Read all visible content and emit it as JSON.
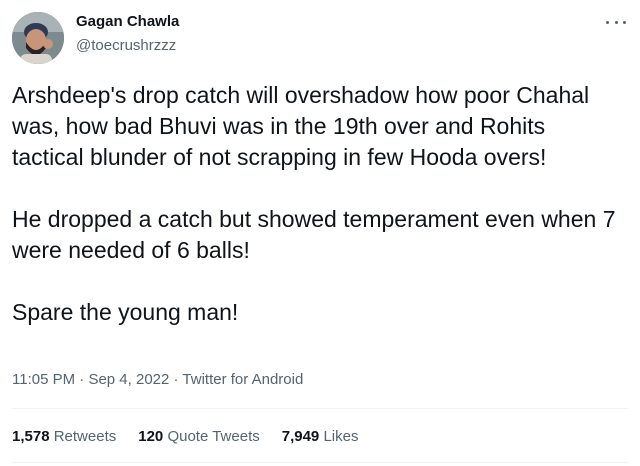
{
  "author": {
    "display_name": "Gagan Chawla",
    "handle": "@toecrushrzzz",
    "avatar_icon": "profile-photo"
  },
  "tweet": {
    "paragraphs": [
      "Arshdeep's drop catch will overshadow how poor Chahal was, how bad Bhuvi was in the 19th over and Rohits tactical blunder of not scrapping in few Hooda overs!",
      "He dropped a catch but showed temperament even when 7 were needed of 6 balls!",
      "Spare the young man!"
    ],
    "time": "11:05 PM",
    "separator": " · ",
    "date": "Sep 4, 2022",
    "source": "Twitter for Android"
  },
  "stats": {
    "retweets_count": "1,578",
    "retweets_label": "Retweets",
    "quotes_count": "120",
    "quotes_label": "Quote Tweets",
    "likes_count": "7,949",
    "likes_label": "Likes"
  },
  "icons": {
    "more": "more-horizontal-icon"
  },
  "colors": {
    "text_primary": "#0f1419",
    "text_secondary": "#536471",
    "divider": "#eff3f4"
  }
}
